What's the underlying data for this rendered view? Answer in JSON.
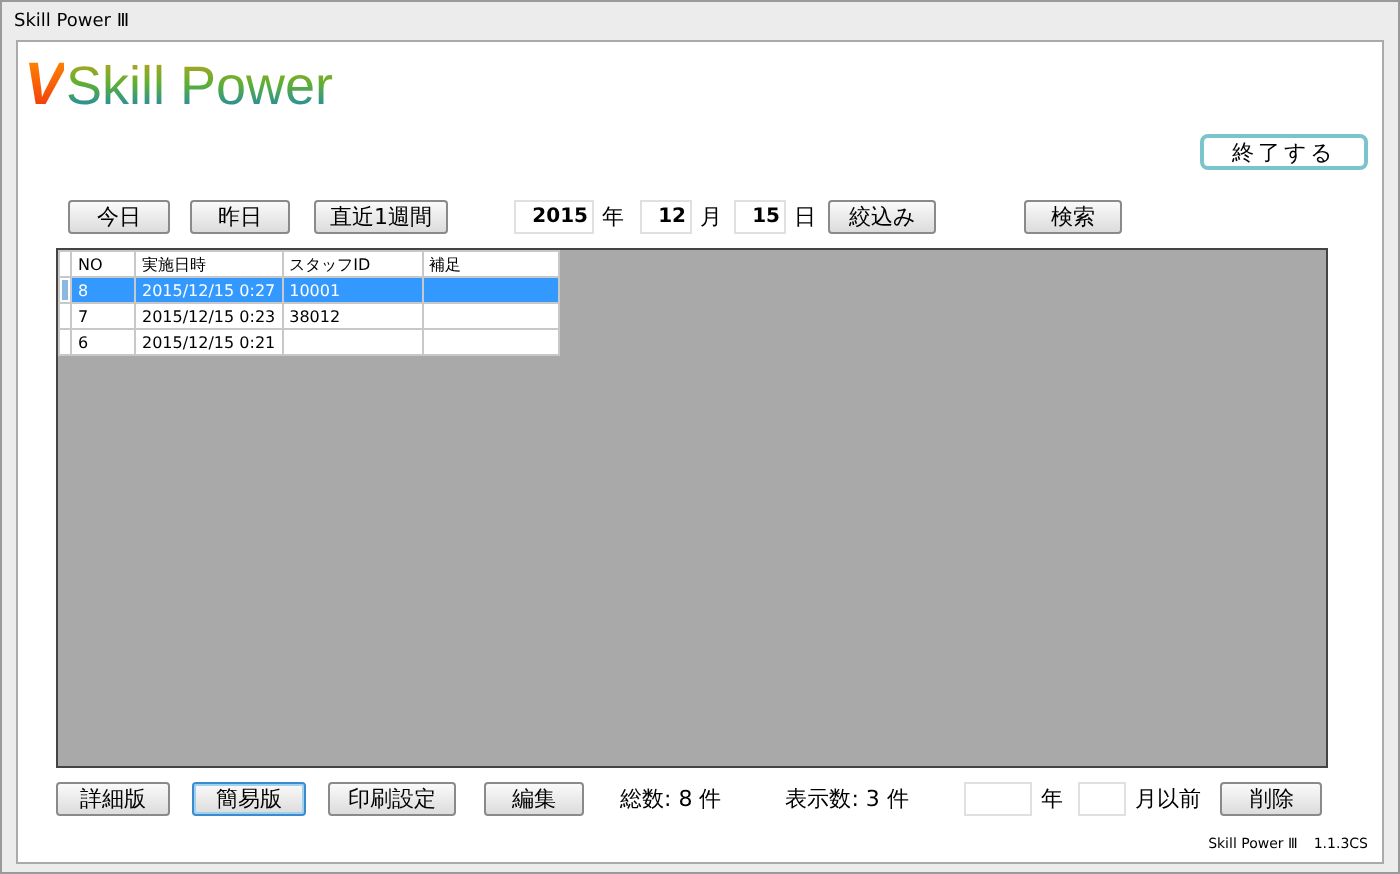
{
  "window": {
    "title": "Skill Power Ⅲ"
  },
  "logo": {
    "mark": "V",
    "text": "Skill Power"
  },
  "exit_button": "終了する",
  "filter_buttons": [
    "今日",
    "昨日",
    "直近1週間"
  ],
  "date": {
    "year": "2015",
    "year_unit": "年",
    "month": "12",
    "month_unit": "月",
    "day": "15",
    "day_unit": "日"
  },
  "narrow_button": "絞込み",
  "search_button": "検索",
  "table": {
    "columns": [
      "NO",
      "実施日時",
      "スタッフID",
      "補足"
    ],
    "rows": [
      {
        "no": "8",
        "datetime": "2015/12/15 0:27",
        "staff_id": "10001",
        "selected": true
      },
      {
        "no": "7",
        "datetime": "2015/12/15 0:23",
        "staff_id": "38012",
        "selected": false
      },
      {
        "no": "6",
        "datetime": "2015/12/15 0:21",
        "selected": false
      }
    ]
  },
  "bottom_buttons": [
    {
      "label": "詳細版",
      "selected": false
    },
    {
      "label": "簡易版",
      "selected": true
    },
    {
      "label": "印刷設定",
      "selected": false
    },
    {
      "label": "編集",
      "selected": false
    }
  ],
  "total": "総数: 8 件",
  "shown": "表示数: 3 件",
  "purge": {
    "year_unit": "年",
    "month_unit": "月以前",
    "button": "削除"
  },
  "version": {
    "app": "Skill Power Ⅲ",
    "number": "1.1.3CS"
  }
}
